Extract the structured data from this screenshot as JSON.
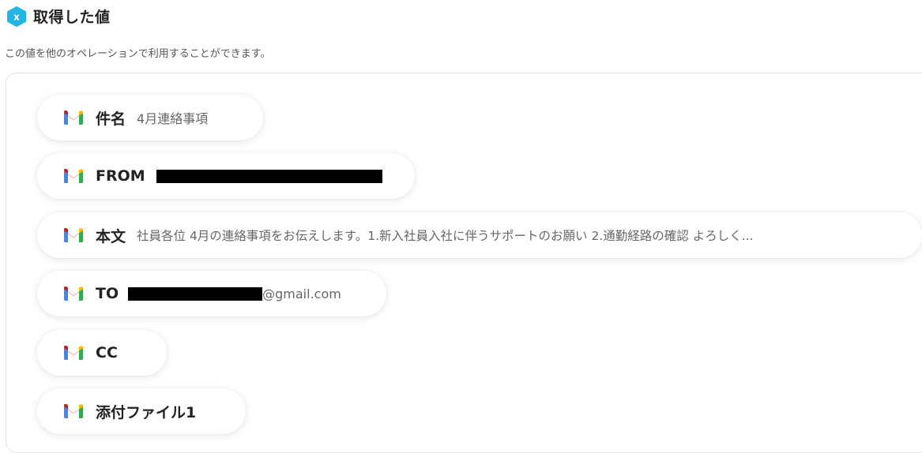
{
  "header": {
    "title": "取得した値",
    "icon": "variable-icon",
    "accent": "#22b5e6"
  },
  "subtitle": "この値を他のオペレーションで利用することができます。",
  "fields": [
    {
      "label": "件名",
      "value": "4月連絡事項"
    },
    {
      "label": "FROM",
      "value": ""
    },
    {
      "label": "本文",
      "value": "社員各位 4月の連絡事項をお伝えします。1.新入社員入社に伴うサポートのお願い 2.通勤経路の確認 よろしく..."
    },
    {
      "label": "TO",
      "value": "@gmail.com"
    },
    {
      "label": "CC",
      "value": ""
    },
    {
      "label": "添付ファイル1",
      "value": ""
    }
  ],
  "gmail_colors": {
    "red": "#ea4335",
    "blue": "#4285f4",
    "green": "#34a853",
    "yellow": "#fbbc04"
  }
}
